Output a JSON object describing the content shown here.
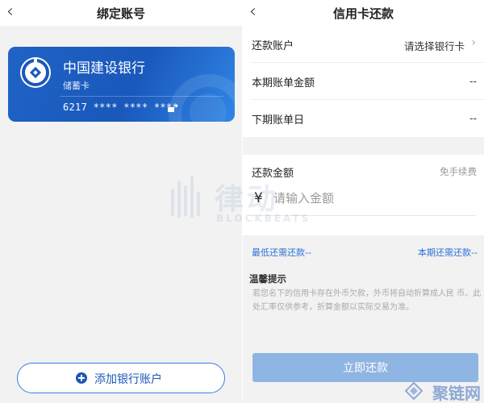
{
  "left_screen": {
    "title": "绑定账号",
    "back_icon": "chevron-left-icon",
    "card": {
      "bank_name": "中国建设银行",
      "card_type": "储蓄卡",
      "card_number": "6217 **** **** ****",
      "logo_icon": "ccb-logo-icon",
      "color": "#1f63c6"
    },
    "add_button_label": "添加银行账户",
    "add_icon": "plus-circle-icon"
  },
  "right_screen": {
    "title": "信用卡还款",
    "back_icon": "chevron-left-icon",
    "rows": [
      {
        "label": "还款账户",
        "value": "请选择银行卡"
      },
      {
        "label": "本期账单金额",
        "value": "--"
      },
      {
        "label": "下期账单日",
        "value": "--"
      }
    ],
    "amount": {
      "label": "还款金额",
      "fee_note": "免手续费",
      "currency": "¥",
      "placeholder": "请输入金额",
      "value": ""
    },
    "links": {
      "min_due": "最低还需还款--",
      "current_due": "本期还需还款--"
    },
    "tips": {
      "title": "温馨提示",
      "text": "若您名下的信用卡存在外币欠款，外币将自动折算成人民 币。此处汇率仅供参考，折算金额以实际交易为准。"
    },
    "pay_button_label": "立即还款",
    "accent_color": "#2a6fd4"
  },
  "watermarks": {
    "center_text": "律动",
    "center_subtext": "BLOCKBEATS",
    "corner_text": "聚链网"
  }
}
